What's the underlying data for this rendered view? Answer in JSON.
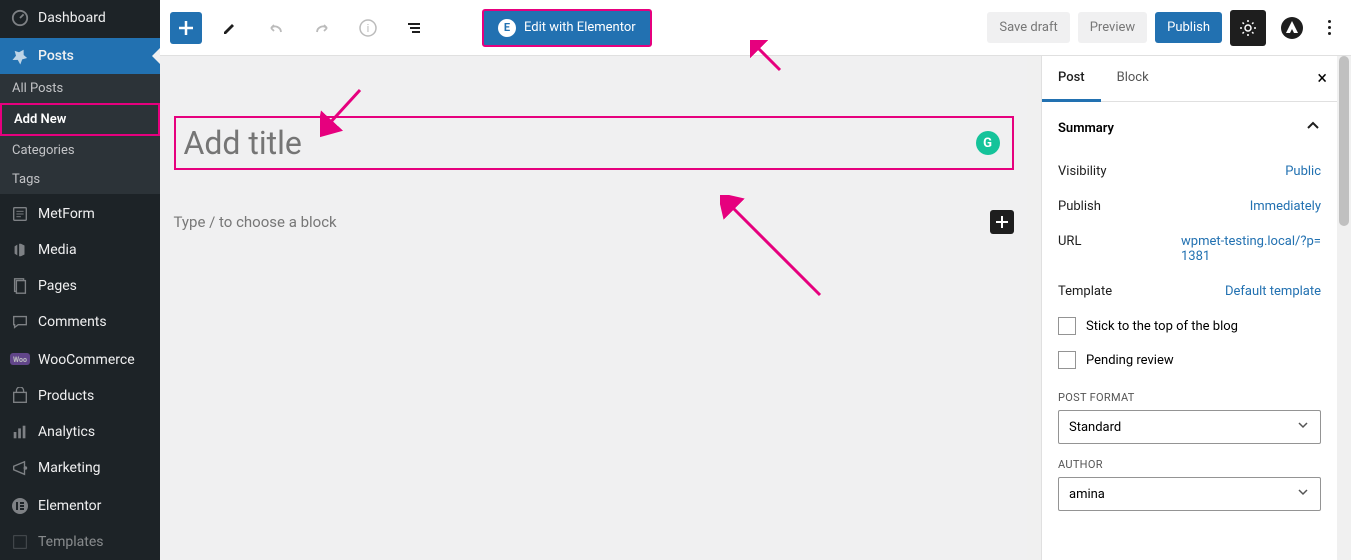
{
  "sidebar": {
    "items": [
      {
        "id": "dashboard",
        "label": "Dashboard"
      },
      {
        "id": "posts",
        "label": "Posts"
      },
      {
        "id": "metform",
        "label": "MetForm"
      },
      {
        "id": "media",
        "label": "Media"
      },
      {
        "id": "pages",
        "label": "Pages"
      },
      {
        "id": "comments",
        "label": "Comments"
      },
      {
        "id": "woocommerce",
        "label": "WooCommerce"
      },
      {
        "id": "products",
        "label": "Products"
      },
      {
        "id": "analytics",
        "label": "Analytics"
      },
      {
        "id": "marketing",
        "label": "Marketing"
      },
      {
        "id": "elementor",
        "label": "Elementor"
      },
      {
        "id": "templates",
        "label": "Templates"
      }
    ],
    "posts_sub": [
      {
        "id": "all",
        "label": "All Posts"
      },
      {
        "id": "add",
        "label": "Add New"
      },
      {
        "id": "cat",
        "label": "Categories"
      },
      {
        "id": "tag",
        "label": "Tags"
      }
    ]
  },
  "toolbar": {
    "elementor_label": "Edit with Elementor",
    "save_draft": "Save draft",
    "preview": "Preview",
    "publish": "Publish"
  },
  "editor": {
    "title_placeholder": "Add title",
    "block_placeholder": "Type / to choose a block",
    "grammarly": "G"
  },
  "panel": {
    "tabs": [
      {
        "id": "post",
        "label": "Post"
      },
      {
        "id": "block",
        "label": "Block"
      }
    ],
    "summary_title": "Summary",
    "rows": [
      {
        "label": "Visibility",
        "value": "Public"
      },
      {
        "label": "Publish",
        "value": "Immediately"
      },
      {
        "label": "URL",
        "value": "wpmet-testing.local/?p=1381"
      },
      {
        "label": "Template",
        "value": "Default template"
      }
    ],
    "checkboxes": [
      {
        "label": "Stick to the top of the blog"
      },
      {
        "label": "Pending review"
      }
    ],
    "post_format": {
      "label": "POST FORMAT",
      "value": "Standard"
    },
    "author": {
      "label": "AUTHOR",
      "value": "amina"
    }
  }
}
